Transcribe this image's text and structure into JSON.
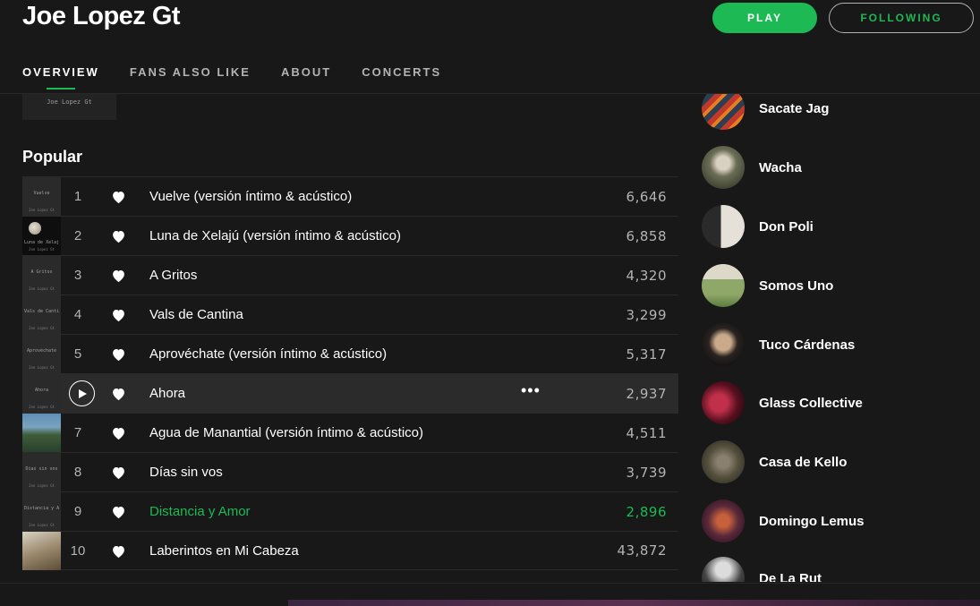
{
  "header": {
    "artist_name": "Joe Lopez Gt",
    "play_label": "PLAY",
    "following_label": "FOLLOWING"
  },
  "tabs": [
    {
      "label": "OVERVIEW",
      "active": true
    },
    {
      "label": "FANS ALSO LIKE",
      "active": false
    },
    {
      "label": "ABOUT",
      "active": false
    },
    {
      "label": "CONCERTS",
      "active": false
    }
  ],
  "album_thumb_text": "Joe Lopez Gt",
  "popular": {
    "title": "Popular",
    "tracks": [
      {
        "num": "1",
        "title": "Vuelve (versión íntimo & acústico)",
        "plays": "6,646",
        "cover_text": "Vuelve"
      },
      {
        "num": "2",
        "title": "Luna de Xelajú (versión íntimo & acústico)",
        "plays": "6,858",
        "cover_text": "Luna de Xelajú"
      },
      {
        "num": "3",
        "title": "A Gritos",
        "plays": "4,320",
        "cover_text": "A Gritos"
      },
      {
        "num": "4",
        "title": "Vals de Cantina",
        "plays": "3,299",
        "cover_text": "Vals de Cantina"
      },
      {
        "num": "5",
        "title": "Aprovéchate (versión íntimo & acústico)",
        "plays": "5,317",
        "cover_text": "Aprovéchate"
      },
      {
        "num": "6",
        "title": "Ahora",
        "plays": "2,937",
        "cover_text": "Ahora",
        "more": "•••"
      },
      {
        "num": "7",
        "title": "Agua de Manantial (versión íntimo & acústico)",
        "plays": "4,511",
        "cover_text": ""
      },
      {
        "num": "8",
        "title": "Días sin vos",
        "plays": "3,739",
        "cover_text": "Días sin vos"
      },
      {
        "num": "9",
        "title": "Distancia y Amor",
        "plays": "2,896",
        "cover_text": "Distancia y Amor"
      },
      {
        "num": "10",
        "title": "Laberintos en Mi Cabeza",
        "plays": "43,872",
        "cover_text": ""
      }
    ]
  },
  "related_artists": [
    {
      "name": "Sacate Jag"
    },
    {
      "name": "Wacha"
    },
    {
      "name": "Don Poli"
    },
    {
      "name": "Somos Uno"
    },
    {
      "name": "Tuco Cárdenas"
    },
    {
      "name": "Glass Collective"
    },
    {
      "name": "Casa de Kello"
    },
    {
      "name": "Domingo Lemus"
    },
    {
      "name": "De La Rut"
    }
  ],
  "colors": {
    "accent": "#1db954",
    "background": "#181818",
    "hover_row": "#2b2b2b",
    "muted_text": "#b3b3b3"
  }
}
